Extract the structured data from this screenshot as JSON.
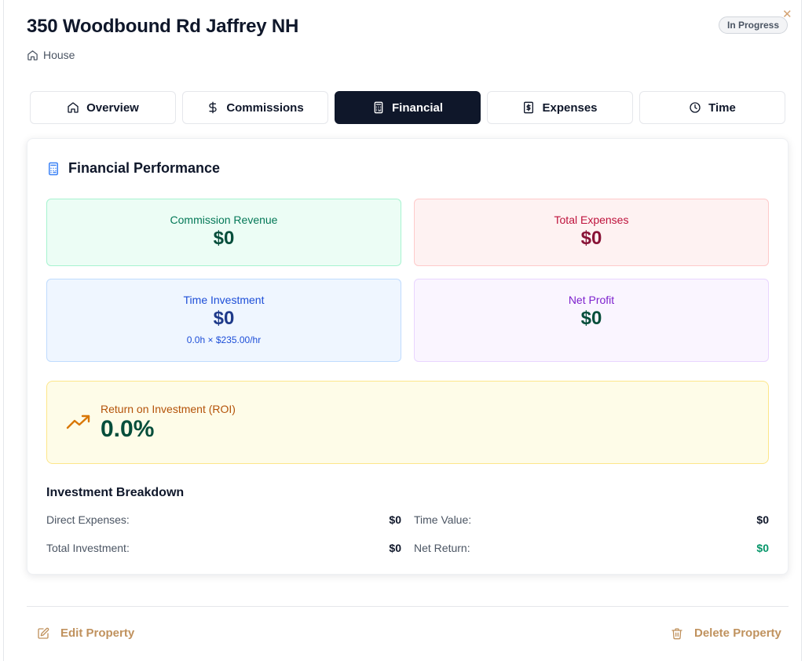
{
  "property": {
    "title": "350 Woodbound Rd Jaffrey NH",
    "type": "House",
    "status": "In Progress"
  },
  "tabs": [
    {
      "label": "Overview",
      "icon": "home-icon",
      "active": false
    },
    {
      "label": "Commissions",
      "icon": "dollar-icon",
      "active": false
    },
    {
      "label": "Financial",
      "icon": "calculator-icon",
      "active": true
    },
    {
      "label": "Expenses",
      "icon": "receipt-icon",
      "active": false
    },
    {
      "label": "Time",
      "icon": "clock-icon",
      "active": false
    }
  ],
  "financial": {
    "title": "Financial Performance",
    "commission_revenue": {
      "label": "Commission Revenue",
      "value": "$0"
    },
    "total_expenses": {
      "label": "Total Expenses",
      "value": "$0"
    },
    "time_investment": {
      "label": "Time Investment",
      "value": "$0",
      "detail": "0.0h × $235.00/hr"
    },
    "net_profit": {
      "label": "Net Profit",
      "value": "$0"
    },
    "roi": {
      "label": "Return on Investment (ROI)",
      "value": "0.0%"
    },
    "breakdown": {
      "title": "Investment Breakdown",
      "direct_expenses": {
        "label": "Direct Expenses:",
        "value": "$0"
      },
      "time_value": {
        "label": "Time Value:",
        "value": "$0"
      },
      "total_investment": {
        "label": "Total Investment:",
        "value": "$0"
      },
      "net_return": {
        "label": "Net Return:",
        "value": "$0"
      }
    }
  },
  "footer": {
    "edit_label": "Edit Property",
    "delete_label": "Delete Property"
  },
  "colors": {
    "primary_dark": "#0f172a",
    "positive": "#059669",
    "action": "#c0925e"
  }
}
